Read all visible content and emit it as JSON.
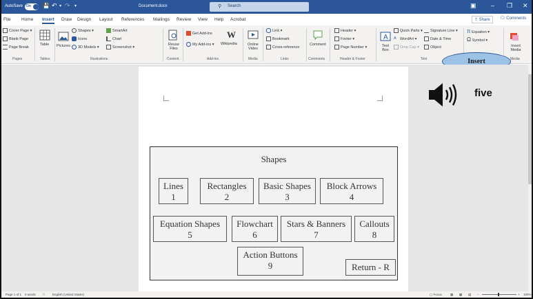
{
  "titlebar": {
    "autosave_label": "AutoSave",
    "autosave_state": "On",
    "doc_name": "Document.docx",
    "search_placeholder": "Search"
  },
  "menu": {
    "tabs": [
      "File",
      "Home",
      "Insert",
      "Draw",
      "Design",
      "Layout",
      "References",
      "Mailings",
      "Review",
      "View",
      "Help",
      "Acrobat"
    ],
    "active_tab": "Insert",
    "share_label": "Share",
    "comments_label": "Comments"
  },
  "ribbon": {
    "pages": {
      "items": [
        "Cover Page",
        "Blank Page",
        "Page Break"
      ],
      "label": "Pages"
    },
    "tables": {
      "table_label": "Table",
      "label": "Tables"
    },
    "illustrations": {
      "pictures_label": "Pictures",
      "shapes": "Shapes",
      "icons": "Icons",
      "models": "3D Models",
      "smartart": "SmartArt",
      "chart": "Chart",
      "screenshot": "Screenshot",
      "label": "Illustrations"
    },
    "content": {
      "reuse": "Reuse Files",
      "label": "Content"
    },
    "addins": {
      "get": "Get Add-ins",
      "my": "My Add-ins",
      "wikipedia": "Wikipedia",
      "label": "Add-ins"
    },
    "media": {
      "online_video": "Online Video",
      "label": "Media"
    },
    "links": {
      "link": "Link",
      "bookmark": "Bookmark",
      "cross_ref": "Cross-reference",
      "label": "Links"
    },
    "comments": {
      "comment": "Comment",
      "label": "Comments"
    },
    "header_footer": {
      "header": "Header",
      "footer": "Footer",
      "page_number": "Page Number",
      "label": "Header & Footer"
    },
    "text": {
      "text_box": "Text Box",
      "quick_parts": "Quick Parts",
      "wordart": "WordArt",
      "drop_cap": "Drop Cap",
      "signature": "Signature Line",
      "datetime": "Date & Time",
      "object": "Object",
      "label": "Text"
    },
    "symbols": {
      "equation": "Equation",
      "symbol": "Symbol"
    },
    "media2": {
      "insert_media": "Insert Media",
      "label": "Media"
    }
  },
  "callout": {
    "text": "Insert"
  },
  "overlay": {
    "speaker_label": "five"
  },
  "shapes_menu": {
    "title": "Shapes",
    "categories": [
      {
        "name": "Lines",
        "key": "1"
      },
      {
        "name": "Rectangles",
        "key": "2"
      },
      {
        "name": "Basic Shapes",
        "key": "3"
      },
      {
        "name": "Block Arrows",
        "key": "4"
      },
      {
        "name": "Equation Shapes",
        "key": "5"
      },
      {
        "name": "Flowchart",
        "key": "6"
      },
      {
        "name": "Stars & Banners",
        "key": "7"
      },
      {
        "name": "Callouts",
        "key": "8"
      },
      {
        "name": "Action Buttons",
        "key": "9"
      }
    ],
    "return_label": "Return - R"
  },
  "statusbar": {
    "page": "Page 1 of 1",
    "words": "0 words",
    "language": "English (United States)",
    "focus": "Focus",
    "zoom": "100%"
  }
}
